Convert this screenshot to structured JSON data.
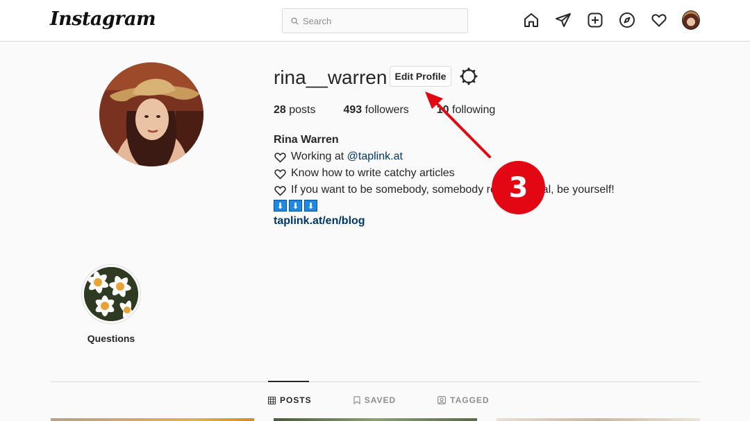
{
  "header": {
    "logo": "Instagram",
    "search_placeholder": "Search",
    "icons": [
      "home-icon",
      "direct-send-icon",
      "new-post-icon",
      "explore-icon",
      "activity-heart-icon",
      "profile-avatar"
    ]
  },
  "profile": {
    "username": "rina__warren",
    "edit_label": "Edit Profile",
    "stats": {
      "posts_count": "28",
      "posts_label": " posts",
      "followers_count": "493",
      "followers_label": " followers",
      "following_count": "10",
      "following_label": " following"
    },
    "bio": {
      "name": "Rina Warren",
      "line1_prefix": "Working at ",
      "line1_link": "@taplink.at",
      "line2": "Know how to write catchy articles",
      "line3": "If you want to be somebody, somebody really special, be yourself!",
      "arrows": [
        "⬇",
        "⬇",
        "⬇"
      ],
      "website": "taplink.at/en/blog"
    }
  },
  "highlights": [
    {
      "label": "Questions"
    }
  ],
  "tabs": [
    {
      "label": "POSTS",
      "icon": "grid-icon",
      "active": true
    },
    {
      "label": "SAVED",
      "icon": "bookmark-icon",
      "active": false
    },
    {
      "label": "TAGGED",
      "icon": "tagged-icon",
      "active": false
    }
  ],
  "annotation": {
    "step_number": "3",
    "color": "#e30613"
  }
}
